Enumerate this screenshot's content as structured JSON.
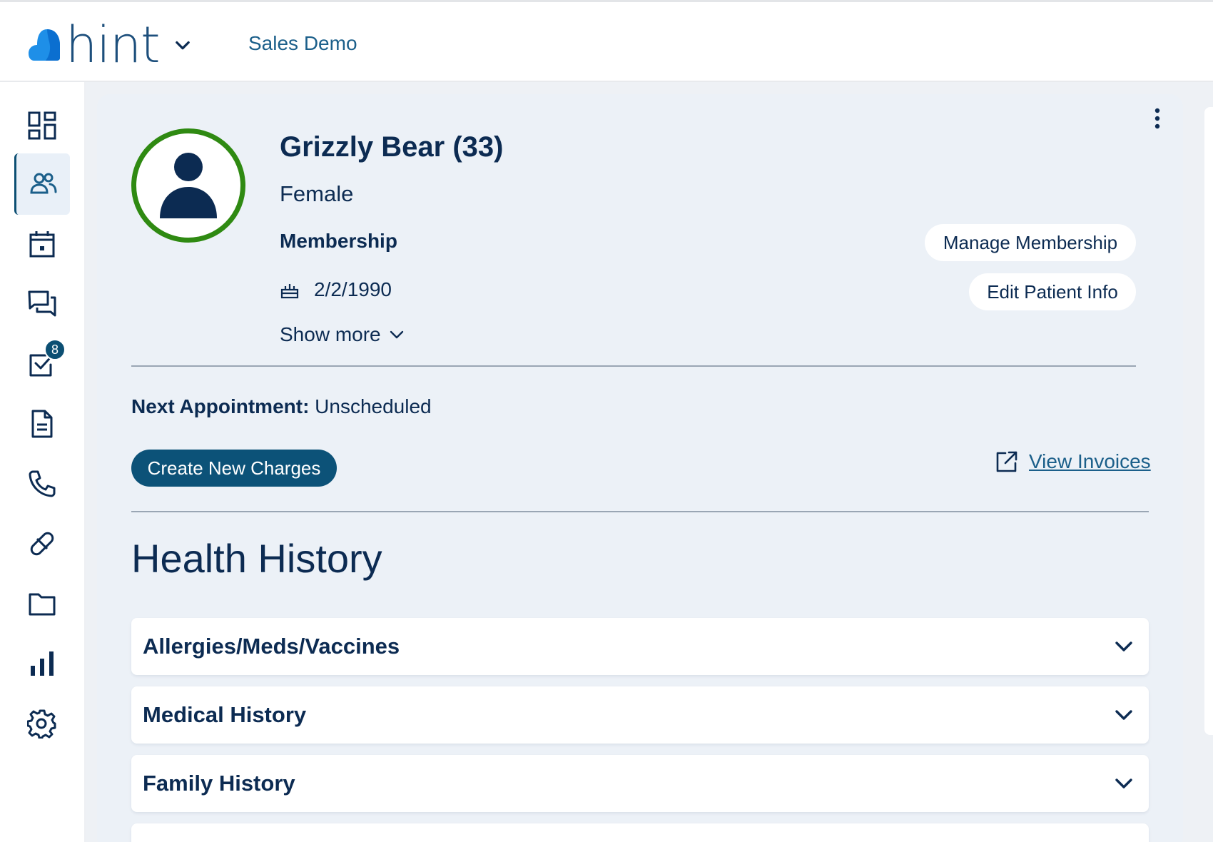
{
  "header": {
    "logo_text": "hint",
    "org_name": "Sales Demo"
  },
  "sidebar": {
    "items": [
      {
        "name": "dashboard",
        "icon": "dashboard-icon"
      },
      {
        "name": "patients",
        "icon": "people-icon",
        "active": true
      },
      {
        "name": "calendar",
        "icon": "calendar-icon"
      },
      {
        "name": "messages",
        "icon": "chat-icon"
      },
      {
        "name": "tasks",
        "icon": "checkbox-icon",
        "badge": "8"
      },
      {
        "name": "documents",
        "icon": "document-icon"
      },
      {
        "name": "phone",
        "icon": "phone-icon"
      },
      {
        "name": "medications",
        "icon": "pill-icon"
      },
      {
        "name": "files",
        "icon": "folder-icon"
      },
      {
        "name": "reports",
        "icon": "bar-chart-icon"
      },
      {
        "name": "settings",
        "icon": "gear-icon"
      }
    ]
  },
  "patient": {
    "name": "Grizzly Bear (33)",
    "sex": "Female",
    "membership_label": "Membership",
    "dob": "2/2/1990",
    "show_more": "Show more",
    "avatar_ring_color": "#2f8a12"
  },
  "actions": {
    "manage_membership": "Manage Membership",
    "edit_patient_info": "Edit Patient Info",
    "create_new_charges": "Create New Charges",
    "view_invoices": "View Invoices"
  },
  "appointment": {
    "label": "Next Appointment:",
    "value": "Unscheduled"
  },
  "health_history": {
    "title": "Health History",
    "sections": [
      {
        "title": "Allergies/Meds/Vaccines"
      },
      {
        "title": "Medical History"
      },
      {
        "title": "Family History"
      }
    ]
  },
  "colors": {
    "primary": "#0c5278",
    "text": "#0c2b52",
    "accent_link": "#1b5f8a",
    "logo_blue": "#1e8fe8"
  }
}
